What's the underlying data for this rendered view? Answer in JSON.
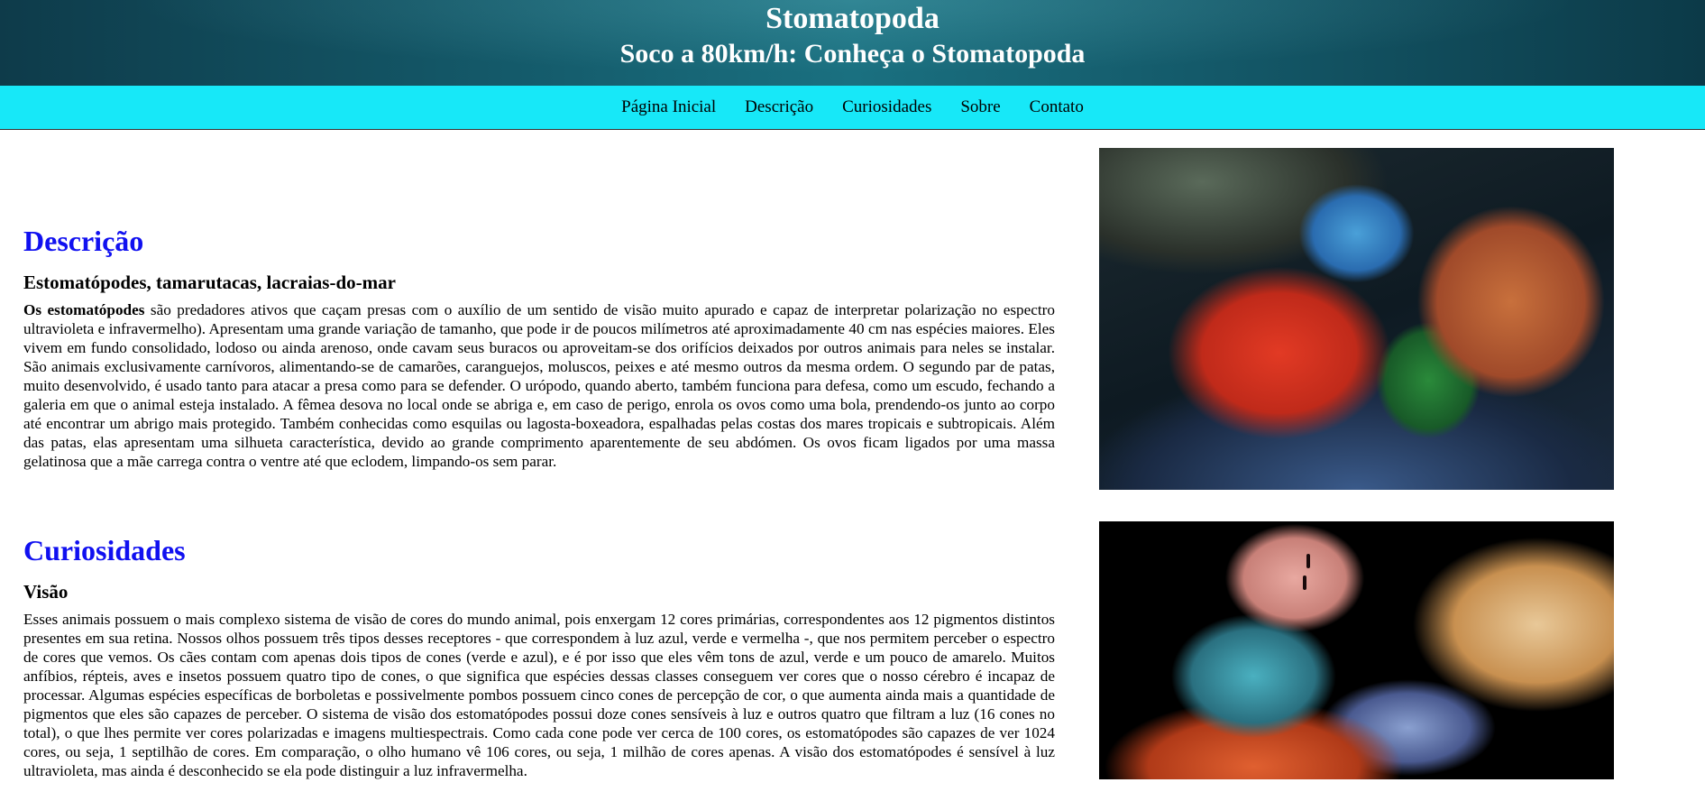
{
  "header": {
    "title": "Stomatopoda",
    "subtitle": "Soco a 80km/h: Conheça o Stomatopoda"
  },
  "nav": {
    "items": [
      "Página Inicial",
      "Descrição",
      "Curiosidades",
      "Sobre",
      "Contato"
    ]
  },
  "descricao": {
    "heading": "Descrição",
    "subheading": "Estomatópodes, tamarutacas, lacraias-do-mar",
    "lead_bold": "Os estomatópodes",
    "text": " são predadores ativos que caçam presas com o auxílio de um sentido de visão muito apurado e capaz de interpretar polarização no espectro ultravioleta e infravermelho). Apresentam uma grande variação de tamanho, que pode ir de poucos milímetros até aproximadamente 40 cm nas espécies maiores. Eles vivem em fundo consolidado, lodoso ou ainda arenoso, onde cavam seus buracos ou aproveitam-se dos orifícios deixados por outros animais para neles se instalar. São animais exclusivamente carnívoros, alimentando-se de camarões, caranguejos, moluscos, peixes e até mesmo outros da mesma ordem. O segundo par de patas, muito desenvolvido, é usado tanto para atacar a presa como para se defender. O urópodo, quando aberto, também funciona para defesa, como um escudo, fechando a galeria em que o animal esteja instalado. A fêmea desova no local onde se abriga e, em caso de perigo, enrola os ovos como uma bola, prendendo-os junto ao corpo até encontrar um abrigo mais protegido. Também conhecidas como esquilas ou lagosta-boxeadora, espalhadas pelas costas dos mares tropicais e subtropicais. Além das patas, elas apresentam uma silhueta característica, devido ao grande comprimento aparentemente de seu abdómen. Os ovos ficam ligados por uma massa gelatinosa que a mãe carrega contra o ventre até que eclodem, limpando-os sem parar."
  },
  "curiosidades": {
    "heading": "Curiosidades",
    "subheading": "Visão",
    "text": "Esses animais possuem o mais complexo sistema de visão de cores do mundo animal, pois enxergam 12 cores primárias, correspondentes aos 12 pigmentos distintos presentes em sua retina. Nossos olhos possuem três tipos desses receptores - que correspondem à luz azul, verde e vermelha -, que nos permitem perceber o espectro de cores que vemos. Os cães contam com apenas dois tipos de cones (verde e azul), e é por isso que eles vêm tons de azul, verde e um pouco de amarelo. Muitos anfíbios, répteis, aves e insetos possuem quatro tipo de cones, o que significa que espécies dessas classes conseguem ver cores que o nosso cérebro é incapaz de processar. Algumas espécies específicas de borboletas e possivelmente pombos possuem cinco cones de percepção de cor, o que aumenta ainda mais a quantidade de pigmentos que eles são capazes de perceber. O sistema de visão dos estomatópodes possui doze cones sensíveis à luz e outros quatro que filtram a luz (16 cones no total), o que lhes permite ver cores polarizadas e imagens multiespectrais. Como cada cone pode ver cerca de 100 cores, os estomatópodes são capazes de ver 1024 cores, ou seja, 1 septilhão de cores. Em comparação, o olho humano vê 106 cores, ou seja, 1 milhão de cores apenas. A visão dos estomatópodes é sensível à luz ultravioleta, mas ainda é desconhecido se ela pode distinguir a luz infravermelha."
  },
  "images": {
    "photo1_icon": "mantis-shrimp-photo",
    "photo2_icon": "mantis-shrimp-eye-closeup-photo"
  },
  "colors": {
    "heading_blue": "#1010f0",
    "nav_cyan": "#17e8f8",
    "banner_teal": "#145a6a"
  }
}
